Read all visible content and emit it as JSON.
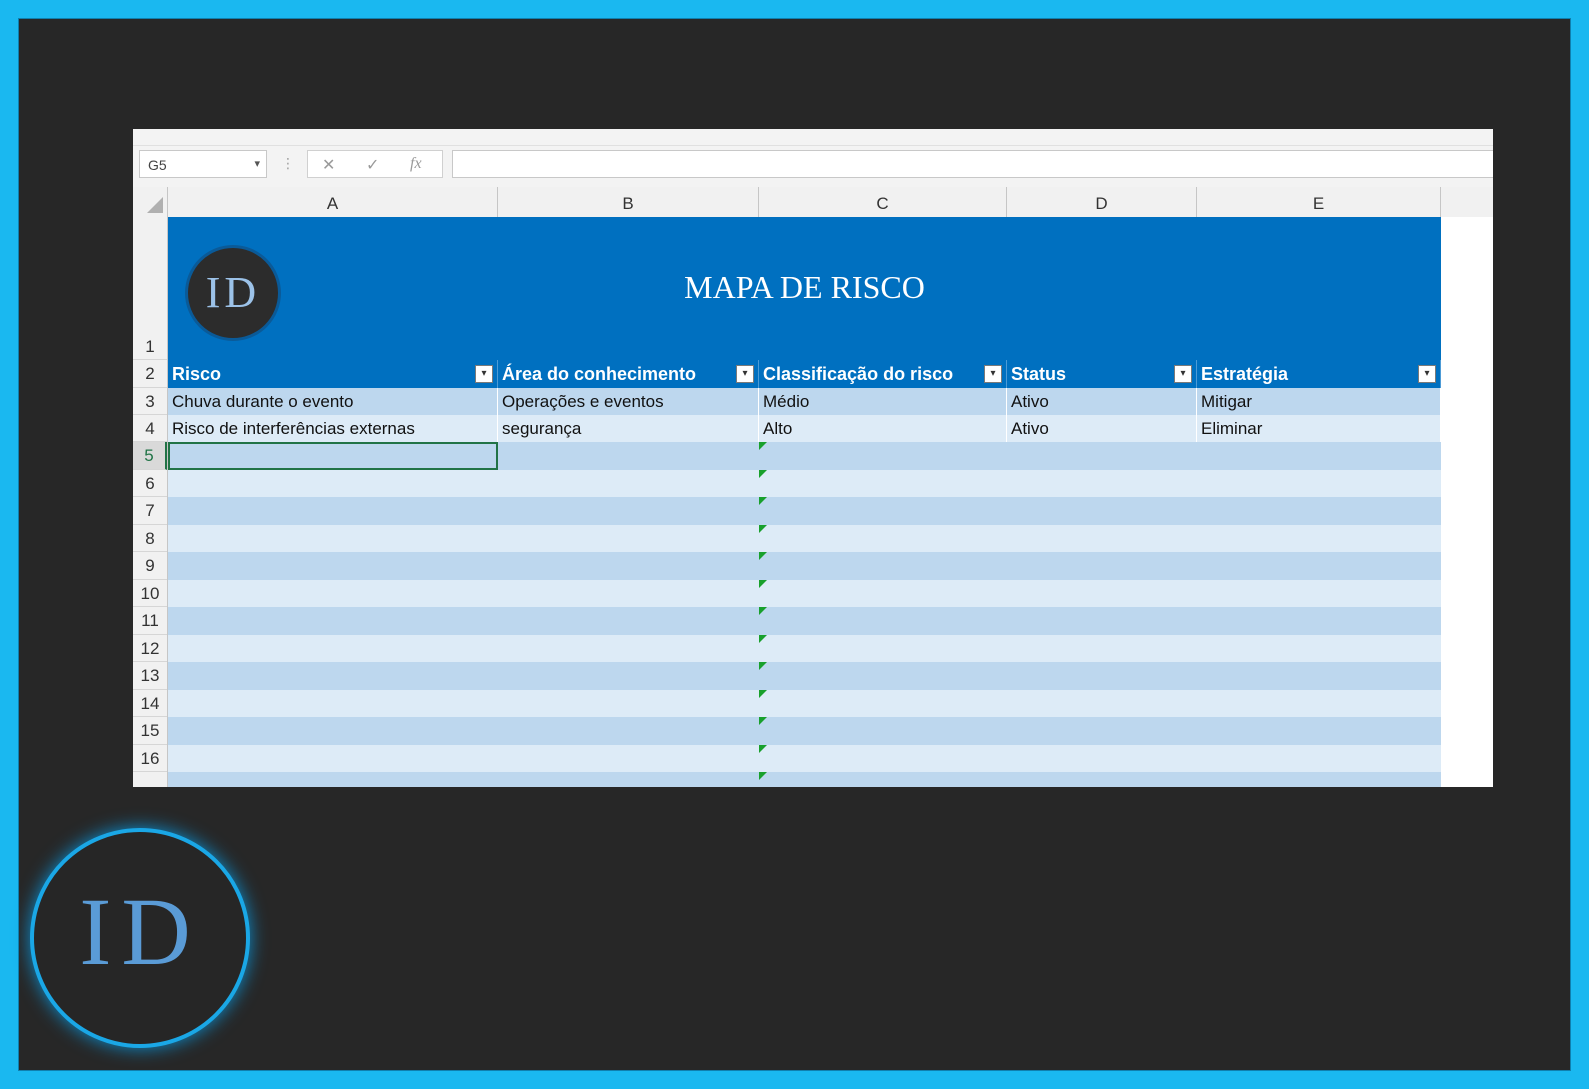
{
  "formula_bar": {
    "name_box": "G5",
    "dropdown_icon": "▾",
    "separator": "⋮",
    "cancel_icon": "✕",
    "enter_icon": "✓",
    "function_icon": "fx",
    "formula": ""
  },
  "columns": [
    "A",
    "B",
    "C",
    "D",
    "E"
  ],
  "rows": [
    "1",
    "2",
    "3",
    "4",
    "5",
    "6",
    "7",
    "8",
    "9",
    "10",
    "11",
    "12",
    "13",
    "14",
    "15",
    "16"
  ],
  "sheet": {
    "title": "MAPA DE RISCO",
    "logo_text": "ID",
    "headers": [
      "Risco",
      "Área do conhecimento",
      "Classificação do risco",
      "Status",
      "Estratégia"
    ],
    "filter_icon": "▾",
    "data": [
      [
        "Chuva durante o evento",
        "Operações e eventos",
        "Médio",
        "Ativo",
        "Mitigar"
      ],
      [
        "Risco de interferências externas",
        "segurança",
        "Alto",
        "Ativo",
        "Eliminar"
      ]
    ],
    "selected_cell": "G5"
  },
  "watermark": {
    "logo_text": "ID"
  },
  "colors": {
    "frame": "#1ab8f0",
    "background": "#272727",
    "table_header": "#0070c0",
    "band_dark": "#bdd7ee",
    "band_light": "#ddebf7",
    "selection": "#217346"
  }
}
